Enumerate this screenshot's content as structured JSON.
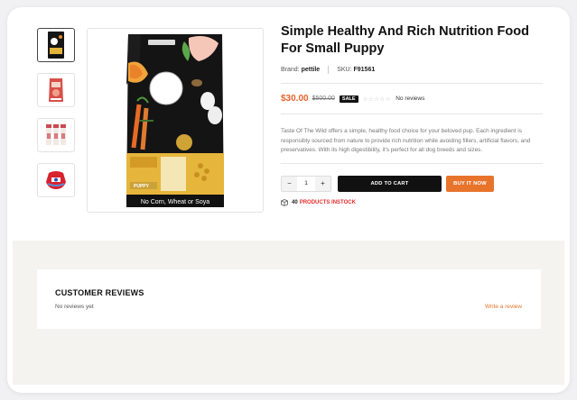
{
  "product": {
    "title": "Simple Healthy And Rich Nutrition Food For Small Puppy",
    "brand_label": "Brand:",
    "brand_value": "pettile",
    "sku_label": "SKU:",
    "sku_value": "F91561",
    "price": "$30.00",
    "old_price": "$500.00",
    "sale_badge": "SALE",
    "stars": "☆☆☆☆☆",
    "rating_value": 0,
    "reviews_text": "No reviews",
    "description": "Taste Of The Wild offers a simple, healthy food choice for your beloved pup. Each ingredient is responsibly sourced from nature to provide rich nutrition while avoiding fillers, artificial flavors, and preservatives. With its high digestibility, it's perfect for all dog breeds and sizes.",
    "quantity": "1",
    "minus": "−",
    "plus": "+",
    "add_to_cart": "ADD TO CART",
    "buy_now": "BUY IT NOW",
    "stock_count": "40",
    "stock_label": "PRODUCTS INSTOCK",
    "bag_bottom_text": "No Corn, Wheat or Soya",
    "bag_tag": "PUPPY"
  },
  "thumbnails": [
    {
      "name": "black-food-bag"
    },
    {
      "name": "red-food-bag"
    },
    {
      "name": "supplement-bottles"
    },
    {
      "name": "dog-sweater"
    }
  ],
  "reviews": {
    "title": "CUSTOMER REVIEWS",
    "empty": "No reviews yet",
    "write": "Write a review"
  },
  "colors": {
    "accent": "#e8742c",
    "price": "#e8632c",
    "stock": "#e32d2d"
  }
}
